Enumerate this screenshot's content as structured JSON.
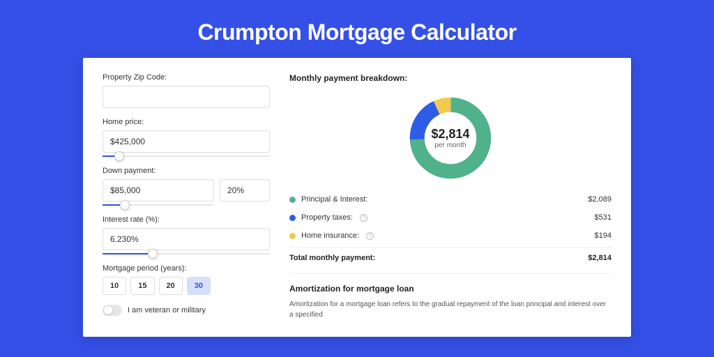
{
  "title": "Crumpton Mortgage Calculator",
  "form": {
    "zip": {
      "label": "Property Zip Code:",
      "value": ""
    },
    "home_price": {
      "label": "Home price:",
      "value": "$425,000",
      "slider_pct": 10
    },
    "down_payment": {
      "label": "Down payment:",
      "amount": "$85,000",
      "pct": "20%",
      "slider_pct": 20
    },
    "interest_rate": {
      "label": "Interest rate (%):",
      "value": "6.230%",
      "slider_pct": 30
    },
    "period": {
      "label": "Mortgage period (years):",
      "options": [
        "10",
        "15",
        "20",
        "30"
      ],
      "selected": "30"
    },
    "veteran": {
      "label": "I am veteran or military",
      "on": false
    }
  },
  "breakdown": {
    "title": "Monthly payment breakdown:",
    "center_value": "$2,814",
    "center_sub": "per month",
    "items": [
      {
        "label": "Principal & Interest:",
        "value": "$2,089",
        "color": "#4FB28B",
        "help": false
      },
      {
        "label": "Property taxes:",
        "value": "$531",
        "color": "#2F5CE6",
        "help": true
      },
      {
        "label": "Home insurance:",
        "value": "$194",
        "color": "#F2C94C",
        "help": true
      }
    ],
    "total_label": "Total monthly payment:",
    "total_value": "$2,814"
  },
  "amortization": {
    "title": "Amortization for mortgage loan",
    "text": "Amortization for a mortgage loan refers to the gradual repayment of the loan principal and interest over a specified"
  },
  "chart_data": {
    "type": "pie",
    "title": "Monthly payment breakdown",
    "series": [
      {
        "name": "Principal & Interest",
        "value": 2089,
        "color": "#4FB28B"
      },
      {
        "name": "Property taxes",
        "value": 531,
        "color": "#2F5CE6"
      },
      {
        "name": "Home insurance",
        "value": 194,
        "color": "#F2C94C"
      }
    ],
    "total": 2814,
    "center_label": "$2,814 per month"
  }
}
